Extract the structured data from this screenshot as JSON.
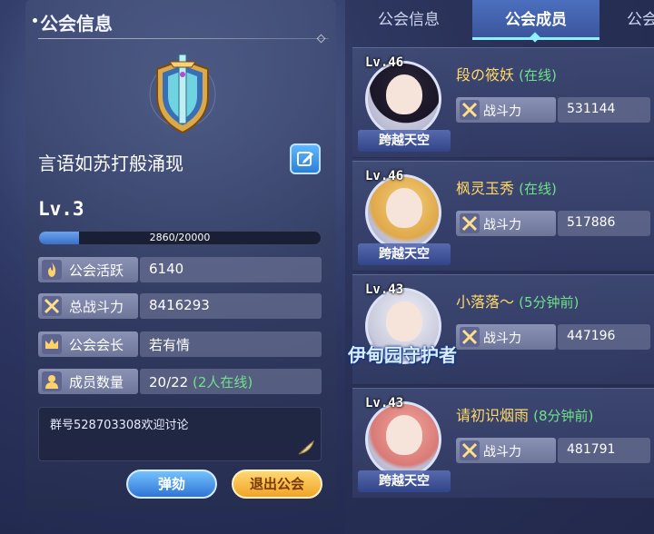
{
  "left_panel": {
    "title": "公会信息",
    "guild_name": "言语如苏打般涌现",
    "level": "Lv.3",
    "exp_text": "2860/20000",
    "exp_fraction": 0.143,
    "stats": [
      {
        "label": "公会活跃",
        "value": "6140",
        "icon": "flame-icon"
      },
      {
        "label": "总战斗力",
        "value": "8416293",
        "icon": "crossed-swords-icon"
      },
      {
        "label": "公会会长",
        "value": "若有情",
        "icon": "crown-icon"
      },
      {
        "label": "成员数量",
        "value": "20/22",
        "extra": "(2人在线)",
        "icon": "person-icon"
      }
    ],
    "notice": "群号528703308欢迎讨论",
    "buttons": {
      "impeach": "弹劾",
      "leave": "退出公会"
    }
  },
  "tabs": {
    "info": "公会信息",
    "members": "公会成员",
    "more": "公会"
  },
  "members": [
    {
      "level": "Lv.46",
      "name": "段の筱妖",
      "status": "(在线)",
      "title": "跨越天空",
      "power_label": "战斗力",
      "power": "531144"
    },
    {
      "level": "Lv.46",
      "name": "枫灵玉秀",
      "status": "(在线)",
      "title": "跨越天空",
      "power_label": "战斗力",
      "power": "517886"
    },
    {
      "level": "Lv.43",
      "name": "小落落～",
      "status": "(5分钟前)",
      "title": "伊甸园守护者",
      "power_label": "战斗力",
      "power": "447196"
    },
    {
      "level": "Lv.43",
      "name": "请初识烟雨",
      "status": "(8分钟前)",
      "title": "跨越天空",
      "power_label": "战斗力",
      "power": "481791"
    }
  ],
  "colors": {
    "online": "#6fe18a",
    "member_name": "#ffd966",
    "accent_tab": "#8ff0ff"
  }
}
